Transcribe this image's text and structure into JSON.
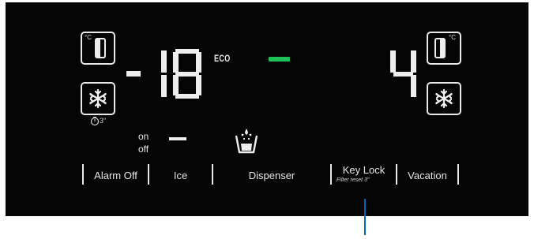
{
  "display": {
    "freezer_sign": "-",
    "freezer_temp": "18",
    "fridge_temp": "4",
    "eco_label": "ECO",
    "eco_indicator_color": "#1fbf5a",
    "freezer_unit": "°C",
    "fridge_unit": "°C",
    "quick_freeze_timer": "3\"",
    "on_label": "on",
    "off_label": "off"
  },
  "buttons": [
    {
      "label": "Alarm Off"
    },
    {
      "label": "Ice"
    },
    {
      "label": "Dispenser"
    },
    {
      "label": "Key Lock",
      "sublabel": "Filter reset 3\""
    },
    {
      "label": "Vacation"
    }
  ],
  "icons": {
    "freezer_temp": "freezer-thermometer-icon",
    "freezer_snow": "snowflake-icon",
    "fridge_temp": "fridge-thermometer-icon",
    "fridge_snow": "snowflake-icon",
    "cup": "water-cup-icon",
    "timer": "timer-icon"
  },
  "colors": {
    "panel": "#050505",
    "segment": "#eeeeee",
    "pointer": "#0b63b0"
  }
}
